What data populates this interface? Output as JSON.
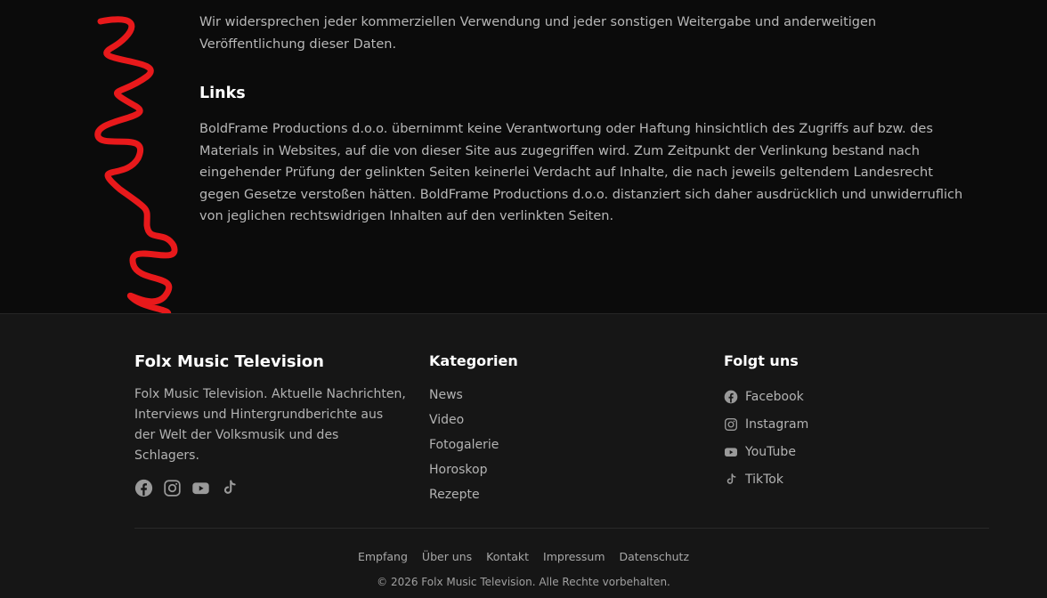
{
  "content": {
    "paragraph1": "Wir widersprechen jeder kommerziellen Verwendung und jeder sonstigen Weitergabe und anderweitigen Veröffentlichung dieser Daten.",
    "links_heading": "Links",
    "paragraph2": "BoldFrame Productions d.o.o. übernimmt keine Verantwortung oder Haftung hinsichtlich des Zugriffs auf bzw. des Materials in Websites, auf die von dieser Site aus zugegriffen wird. Zum Zeitpunkt der Verlinkung bestand nach eingehender Prüfung der gelinkten Seiten keinerlei Verdacht auf Inhalte, die nach jeweils geltendem Landesrecht gegen Gesetze verstoßen hätten. BoldFrame Productions d.o.o. distanziert sich daher ausdrücklich und unwiderruflich von jeglichen rechtswidrigen Inhalten auf den verlinkten Seiten.",
    "squiggle_color": "#e8191b"
  },
  "footer": {
    "brand": {
      "title": "Folx Music Television",
      "description": "Folx Music Television. Aktuelle Nachrichten, Interviews und Hintergrundberichte aus der Welt der Volksmusik und des Schlagers.",
      "icons": [
        "facebook-icon",
        "instagram-icon",
        "youtube-icon",
        "tiktok-icon"
      ]
    },
    "categories": {
      "title": "Kategorien",
      "items": [
        "News",
        "Video",
        "Fotogalerie",
        "Horoskop",
        "Rezepte"
      ]
    },
    "social": {
      "title": "Folgt uns",
      "items": [
        {
          "label": "Facebook",
          "icon": "facebook-icon"
        },
        {
          "label": "Instagram",
          "icon": "instagram-icon"
        },
        {
          "label": "YouTube",
          "icon": "youtube-icon"
        },
        {
          "label": "TikTok",
          "icon": "tiktok-icon"
        }
      ]
    },
    "bottom_links": [
      "Empfang",
      "Über uns",
      "Kontakt",
      "Impressum",
      "Datenschutz"
    ],
    "copyright": "© 2026 Folx Music Television. Alle Rechte vorbehalten.",
    "icon_color": "#9a9a9a"
  }
}
